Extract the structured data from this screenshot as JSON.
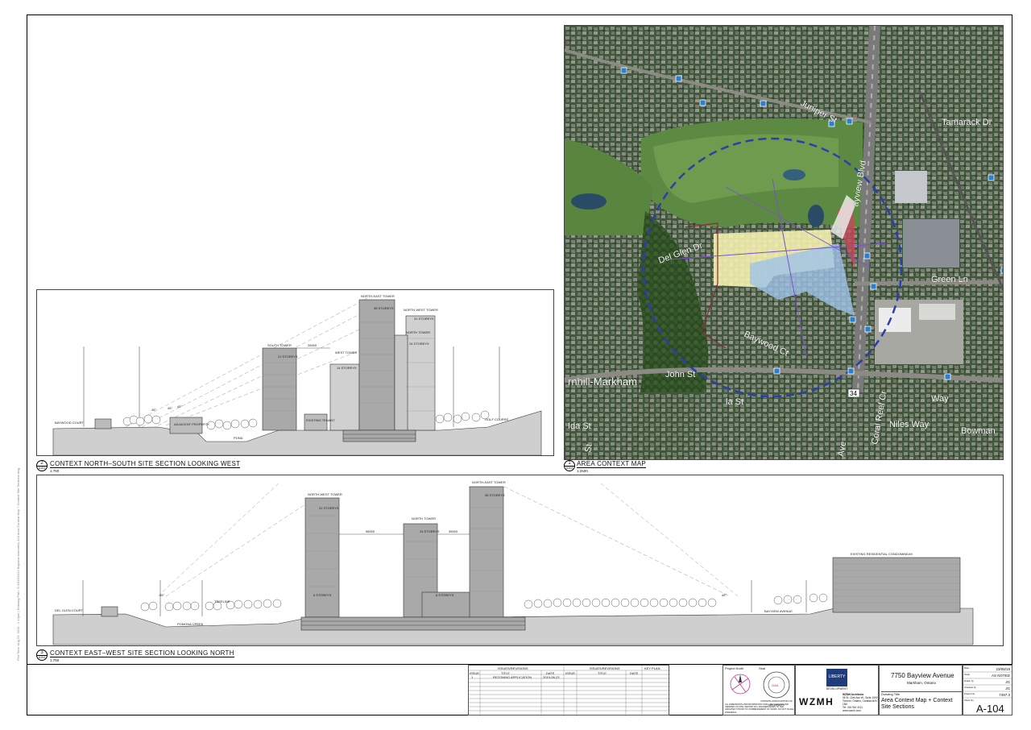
{
  "sheet": {
    "vertical_margin_text": "Plot Time: Aug 23, 2019 - 2:12pm | Drawing Path: S:\\2019\\1910 Bayview Avenue\\A-104 Area Context Map + Context Site Sections.dwg"
  },
  "views": {
    "map": {
      "number": "1",
      "sheet_ref": "A104",
      "title": "AREA CONTEXT MAP",
      "scale": "1:2500",
      "streets": {
        "juniper": "Juniper St",
        "tamarack": "Tamarack Dr",
        "green_ln": "Green Ln",
        "del_glen": "Del Glen Dr",
        "baywood": "Baywood Ct",
        "john_st": "John St",
        "thornhill": "rnhill-Markham",
        "ida": "Ida St",
        "niles": "Niles Way",
        "bowman": "Bowman",
        "coral": "Coral Reef Cr",
        "way": "Way",
        "bayview_ave": "Ave",
        "ila": "la St",
        "st": "St",
        "route": "34",
        "bayview_blvd": "ayview Blvd"
      }
    },
    "section_ns": {
      "number": "2",
      "sheet_ref": "A104",
      "title": "CONTEXT NORTH–SOUTH SITE SECTION LOOKING WEST",
      "scale": "1:750",
      "labels": {
        "baywood_court": "BAYWOOD COURT",
        "adjacent_property": "ADJACENT PROPERTY",
        "pond": "POND",
        "existing_tenant": "EXISTING TENANT",
        "golf_course": "GOLF COURSE",
        "south_tower": "SOUTH TOWER",
        "south_storeys": "21 STOREYS",
        "west_tower": "WEST TOWER",
        "west_storeys": "14 STOREYS",
        "ne_tower": "NORTH-EAST TOWER",
        "ne_storeys": "38 STOREYS",
        "nw_tower": "NORTH-WEST TOWER",
        "nw_storeys": "31 STOREYS",
        "n_tower": "NORTH TOWER",
        "n_storeys": "24 STOREYS",
        "dim_1": "25000",
        "ang_1": "45°",
        "ang_2": "45°",
        "ang_3": "45°"
      }
    },
    "section_ew": {
      "number": "3",
      "sheet_ref": "A104",
      "title": "CONTEXT EAST–WEST SITE SECTION LOOKING NORTH",
      "scale": "1:750",
      "labels": {
        "delglen_court": "DEL GLEN COURT",
        "pomona_creek": "POMONA CREEK",
        "nw_tower": "NORTH-WEST TOWER",
        "nw_storeys": "31 STOREYS",
        "n_tower": "NORTH TOWER",
        "n_storeys": "24 STOREYS",
        "ne_tower": "NORTH-EAST TOWER",
        "ne_storeys": "38 STOREYS",
        "podium_a": "6 STOREYS",
        "podium_b": "8 STOREYS",
        "dim_a": "58000",
        "dim_b": "35000",
        "bayview_avenue": "BAYVIEW AVENUE",
        "existing_condo": "EXISTING RESIDENTIAL CONDOMINIUM",
        "ang_1": "45°",
        "ang_2": "45°",
        "treeline": "TREELINE"
      }
    }
  },
  "title_block": {
    "issues_header_1": "ISSUES/REVISIONS",
    "issues_header_2": "ISSUES/REVISIONS",
    "key_plan": "KEY PLAN",
    "col_no": "ISSUE",
    "col_title": "TITLE",
    "col_date": "DATE",
    "col_no_2": "ISSUE",
    "col_title_2": "TITLE",
    "col_date_2": "DATE",
    "row1_no": "1",
    "row1_title": "REZONING APPLICATION",
    "row1_date": "2019-08-23",
    "project_north": "Project North",
    "seal": "Seal",
    "stamp_text": "ONTARIO ASSOCIATION OF ARCHITECTS",
    "stamp_name": "WZMH",
    "notes": "ALL DIMENSIONS AND INFORMATION SHALL BE CHECKED AND VERIFIED ON SITE. REPORT ANY DISCREPANCIES TO THE ARCHITECT PRIOR TO COMMENCEMENT OF WORK. DO NOT SCALE DRAWINGS.",
    "client_name": "LIBERTY",
    "client_sub": "DEVELOPMENT",
    "firm": "WZMH",
    "firm_name": "WZMH Architects",
    "firm_addr_1": "95 St. Clair Ave W., Suite 1500",
    "firm_addr_2": "Toronto, Ontario, Canada M4V 1N6",
    "firm_tel": "Tel. 416 961 4111",
    "firm_web": "www.wzmh.com",
    "project_title": "7750 Bayview Avenue",
    "project_location": "Markham, Ontario",
    "drawing_title_label": "Drawing Title",
    "drawing_title_1": "Area Context Map + Context",
    "drawing_title_2": "Site Sections",
    "date_label": "Date",
    "date_value": "23/08/19",
    "scale_label": "Scale",
    "scale_value": "AS NOTED",
    "drawn_label": "Drawn by",
    "drawn_value": "JG",
    "checked_label": "Checked by",
    "checked_value": "JG",
    "project_no_label": "Project No.",
    "project_no_value": "7497.3",
    "sheet_no_label": "Sheet No.",
    "sheet_no": "A-104"
  },
  "colors": {
    "building": "#a9a9a9",
    "building_light": "#d0d0d0",
    "ground": "#cfcfcf",
    "site_yellow": "#f4efb0",
    "site_blue": "#9fc3ea",
    "radius_ring": "#2b3fa8",
    "map_green": "#4e7a3c"
  }
}
